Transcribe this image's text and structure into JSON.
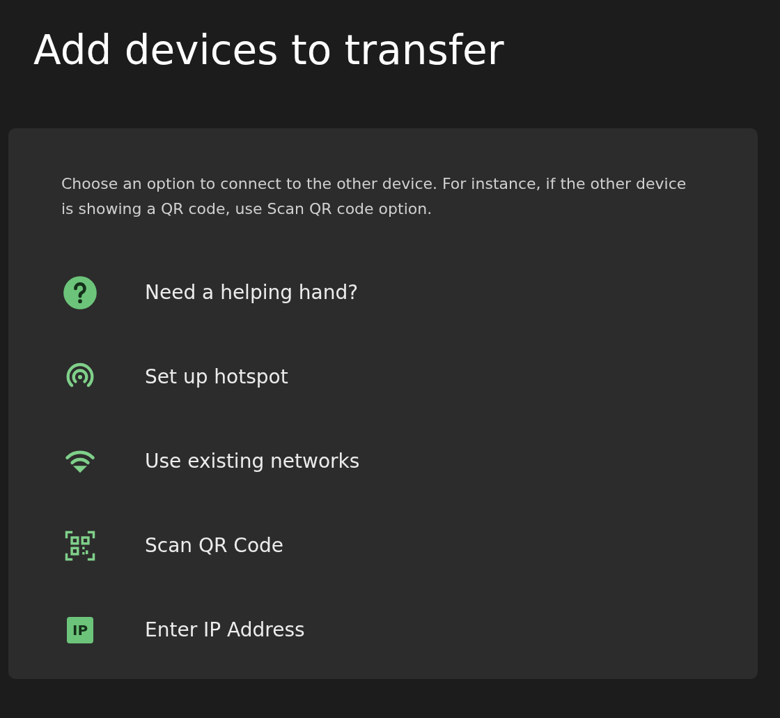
{
  "title": "Add devices to transfer",
  "description": "Choose an option to connect to the other device. For instance, if the other device is showing a QR code, use Scan QR code option.",
  "options": [
    {
      "kind": "help",
      "label": "Need a helping hand?"
    },
    {
      "kind": "hotspot",
      "label": "Set up hotspot"
    },
    {
      "kind": "wifi",
      "label": "Use existing networks"
    },
    {
      "kind": "qr",
      "label": "Scan QR Code"
    },
    {
      "kind": "ip",
      "label": "Enter IP Address",
      "badge": "IP"
    }
  ]
}
